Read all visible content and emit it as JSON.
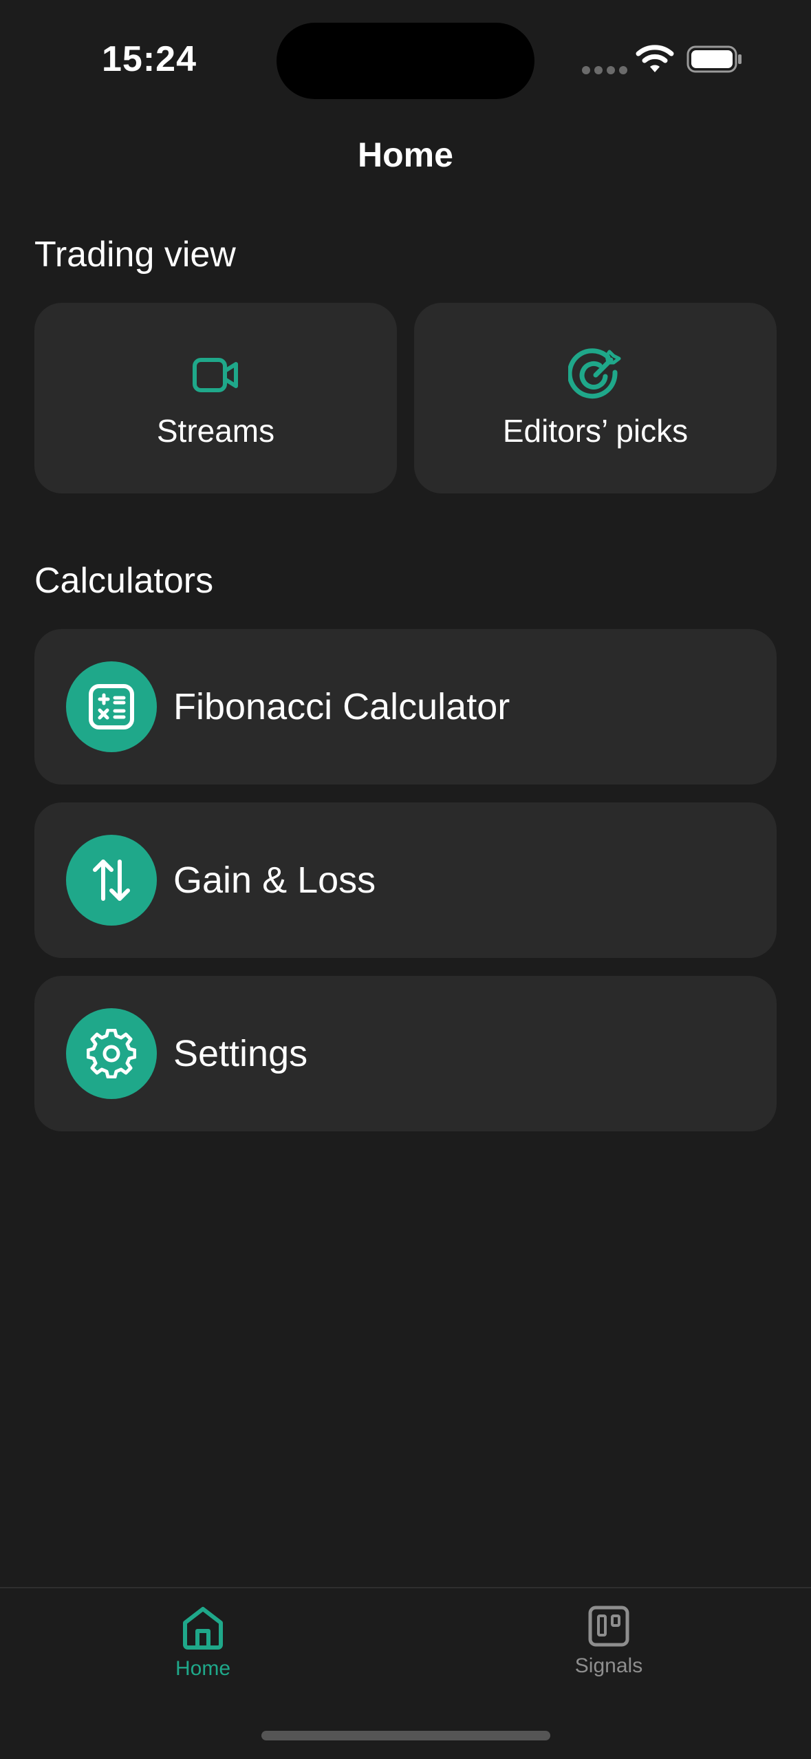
{
  "status_bar": {
    "time": "15:24"
  },
  "nav": {
    "title": "Home"
  },
  "trading_view": {
    "title": "Trading view",
    "tiles": [
      {
        "label": "Streams",
        "icon": "video-camera-icon"
      },
      {
        "label": "Editors’ picks",
        "icon": "target-icon"
      }
    ]
  },
  "calculators": {
    "title": "Calculators",
    "items": [
      {
        "label": "Fibonacci Calculator",
        "icon": "calculator-icon"
      },
      {
        "label": "Gain & Loss",
        "icon": "arrows-up-down-icon"
      },
      {
        "label": "Settings",
        "icon": "gear-icon"
      }
    ]
  },
  "tabbar": {
    "tabs": [
      {
        "label": "Home",
        "icon": "home-icon",
        "active": true
      },
      {
        "label": "Signals",
        "icon": "kanban-board-icon",
        "active": false
      }
    ]
  },
  "colors": {
    "accent": "#1fa88a",
    "background": "#1c1c1c",
    "card": "#2a2a2a",
    "inactive": "#8e8e8e"
  }
}
